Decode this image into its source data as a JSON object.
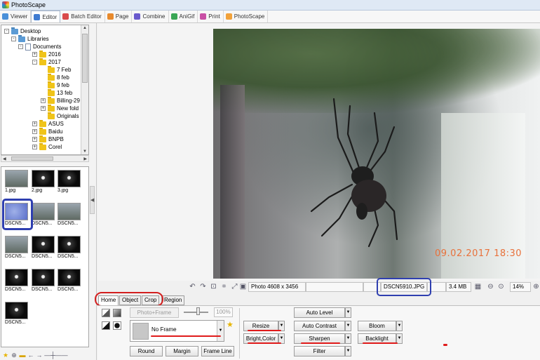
{
  "window": {
    "title": "PhotoScape"
  },
  "tabs": [
    {
      "label": "Viewer",
      "icon": "viewer-icon",
      "color": "#4a90d9"
    },
    {
      "label": "Editor",
      "icon": "editor-icon",
      "color": "#3f7bd1"
    },
    {
      "label": "Batch Editor",
      "icon": "batch-editor-icon",
      "color": "#d94a4a"
    },
    {
      "label": "Page",
      "icon": "page-icon",
      "color": "#e88a2c"
    },
    {
      "label": "Combine",
      "icon": "combine-icon",
      "color": "#6a5acd"
    },
    {
      "label": "AniGif",
      "icon": "anigif-icon",
      "color": "#3aa655"
    },
    {
      "label": "Print",
      "icon": "print-icon",
      "color": "#c94fa5"
    },
    {
      "label": "PhotoScape",
      "icon": "photoscape-icon",
      "color": "#f2a23a"
    }
  ],
  "tree": {
    "items": [
      {
        "label": "Desktop",
        "expander": "-"
      },
      {
        "label": "Libraries",
        "expander": "-"
      },
      {
        "label": "Documents",
        "expander": "-"
      },
      {
        "label": "2016",
        "expander": "+"
      },
      {
        "label": "2017",
        "expander": "-"
      },
      {
        "label": "7 Feb",
        "expander": ""
      },
      {
        "label": "8 feb",
        "expander": ""
      },
      {
        "label": "9 feb",
        "expander": ""
      },
      {
        "label": "13 feb",
        "expander": ""
      },
      {
        "label": "Billing-29",
        "expander": "+"
      },
      {
        "label": "New fold",
        "expander": "+"
      },
      {
        "label": "Originals",
        "expander": ""
      },
      {
        "label": "ASUS",
        "expander": "+"
      },
      {
        "label": "Baidu",
        "expander": "+"
      },
      {
        "label": "BNPB",
        "expander": "+"
      },
      {
        "label": "Corel",
        "expander": "+"
      }
    ]
  },
  "thumbnails": [
    {
      "label": "1.jpg"
    },
    {
      "label": "2.jpg"
    },
    {
      "label": "3.jpg"
    },
    {
      "label": "DSCN5..."
    },
    {
      "label": "DSCN5..."
    },
    {
      "label": "DSCN5..."
    },
    {
      "label": "DSCN5..."
    },
    {
      "label": "DSCN5..."
    },
    {
      "label": "DSCN5..."
    },
    {
      "label": "DSCN5..."
    },
    {
      "label": "DSCN5..."
    },
    {
      "label": "DSCN5..."
    },
    {
      "label": "DSCN5..."
    }
  ],
  "photo": {
    "timestamp": "09.02.2017 18:30"
  },
  "status": {
    "photo_size": "Photo 4608 x 3456",
    "filename": "DSCN5910.JPG",
    "filesize": "3.4 MB",
    "zoom": "14%"
  },
  "edit_tabs": [
    "Home",
    "Object",
    "Crop",
    "Region"
  ],
  "home": {
    "photo_frame": "Photo+Frame",
    "percent": "100%",
    "frame_value": "No Frame",
    "round": "Round",
    "margin": "Margin",
    "frame_line": "Frame Line",
    "resize": "Resize",
    "bright_color": "Bright,Color",
    "auto_level": "Auto Level",
    "auto_contrast": "Auto Contrast",
    "sharpen": "Sharpen",
    "filter": "Filter",
    "bloom": "Bloom",
    "backlight": "Backlight"
  },
  "colors": {
    "annotation_red": "#e01b1b",
    "annotation_blue": "#2f3fb0",
    "timestamp_orange": "#e8713b"
  }
}
